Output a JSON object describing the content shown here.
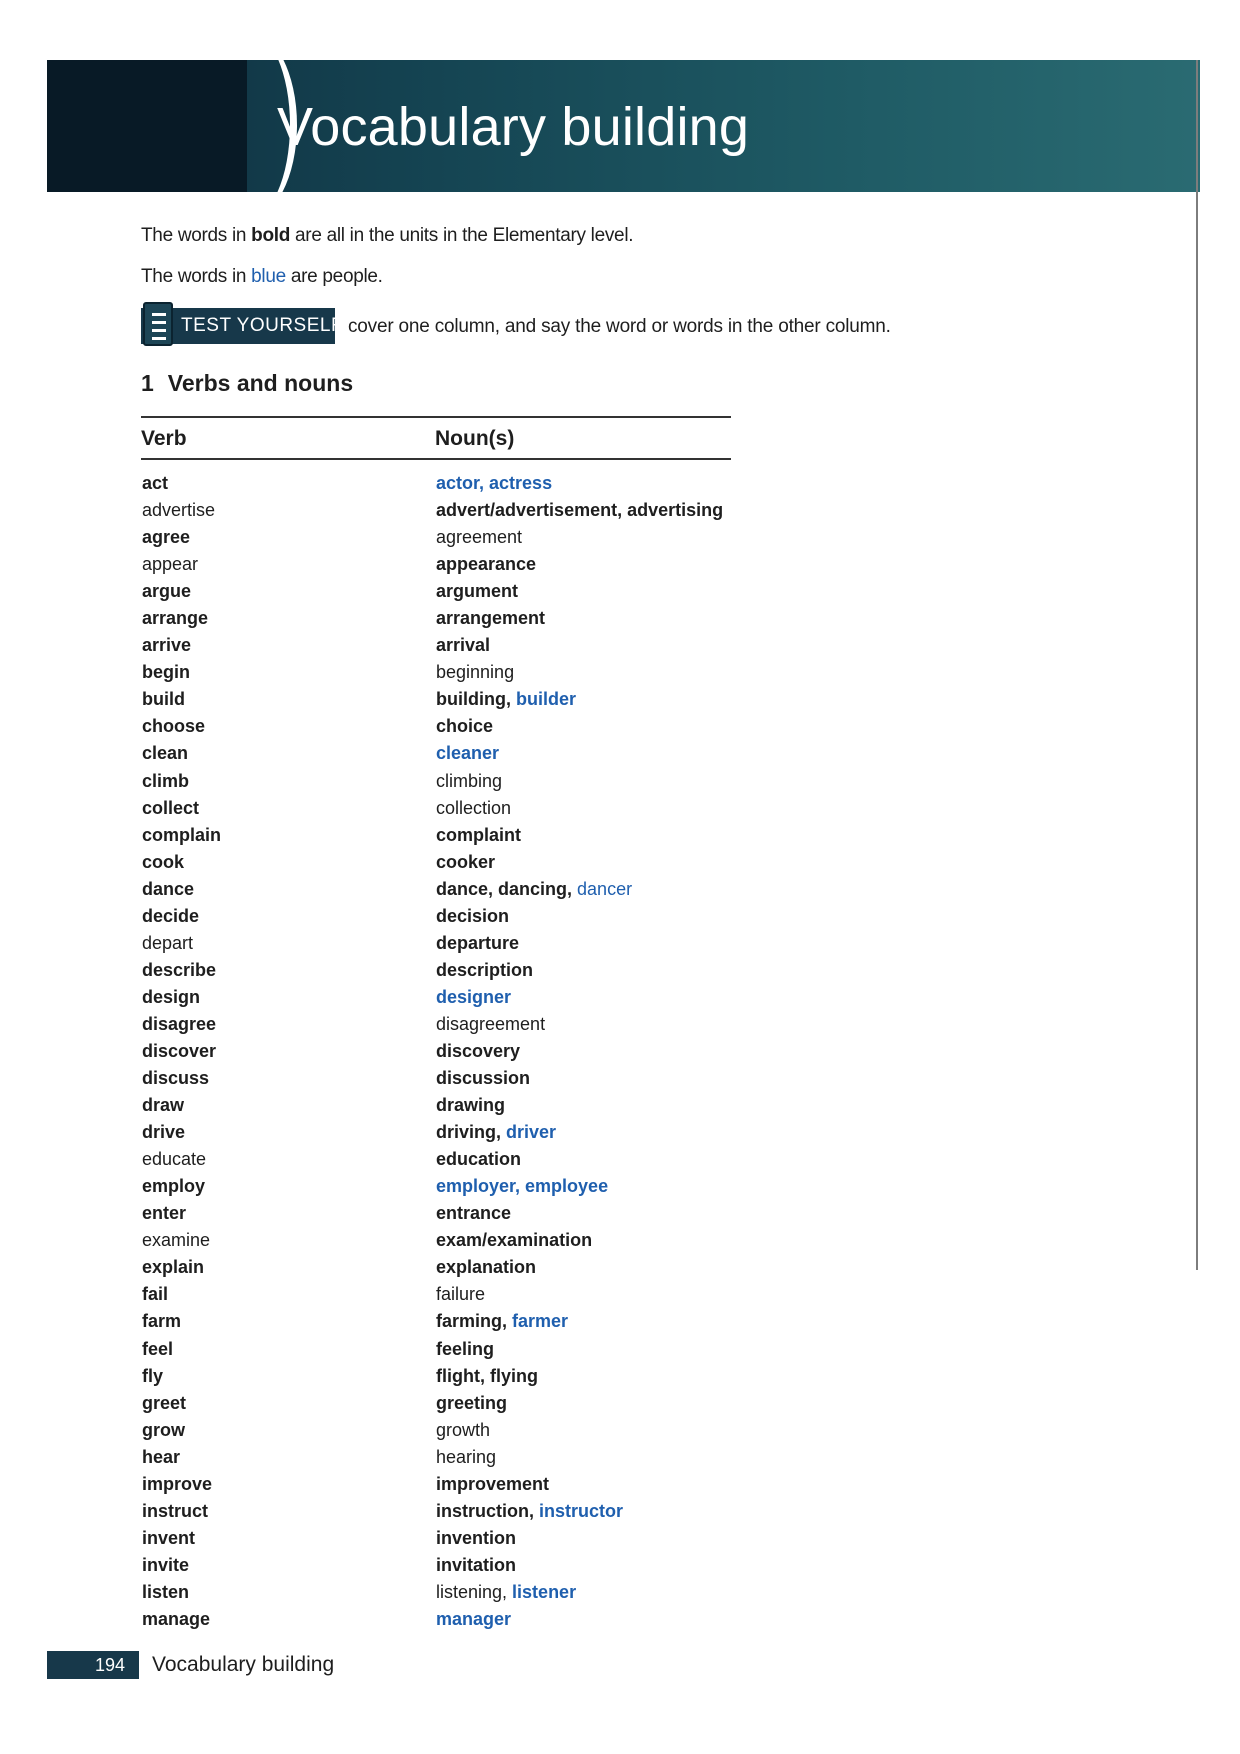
{
  "header": {
    "title": "Vocabulary building"
  },
  "intro": {
    "line1": {
      "pre": "The words in ",
      "bold": "bold",
      "post": " are all in the units in the Elementary level."
    },
    "line2": {
      "pre": "The words in ",
      "blue": "blue",
      "post": " are people."
    }
  },
  "test_yourself": {
    "label": "TEST YOURSELF",
    "text": "cover one column, and say the word or words in the other column."
  },
  "section": {
    "number": "1",
    "title": "Verbs and nouns"
  },
  "colors": {
    "bold_text": "#1e1e1e",
    "people_blue": "#1f5fae",
    "header_band": "#154553"
  },
  "table": {
    "headers": {
      "verb": "Verb",
      "noun": "Noun(s)"
    },
    "rows": [
      {
        "verb": {
          "text": "act",
          "bold": true
        },
        "nouns": [
          {
            "text": "actor, actress",
            "bold": true,
            "blue": true
          }
        ]
      },
      {
        "verb": {
          "text": "advertise",
          "bold": false
        },
        "nouns": [
          {
            "text": "advert/advertisement, advertising",
            "bold": true,
            "blue": false
          }
        ]
      },
      {
        "verb": {
          "text": "agree",
          "bold": true
        },
        "nouns": [
          {
            "text": "agreement",
            "bold": false,
            "blue": false
          }
        ]
      },
      {
        "verb": {
          "text": "appear",
          "bold": false
        },
        "nouns": [
          {
            "text": "appearance",
            "bold": true,
            "blue": false
          }
        ]
      },
      {
        "verb": {
          "text": "argue",
          "bold": true
        },
        "nouns": [
          {
            "text": "argument",
            "bold": true,
            "blue": false
          }
        ]
      },
      {
        "verb": {
          "text": "arrange",
          "bold": true
        },
        "nouns": [
          {
            "text": "arrangement",
            "bold": true,
            "blue": false
          }
        ]
      },
      {
        "verb": {
          "text": "arrive",
          "bold": true
        },
        "nouns": [
          {
            "text": "arrival",
            "bold": true,
            "blue": false
          }
        ]
      },
      {
        "verb": {
          "text": "begin",
          "bold": true
        },
        "nouns": [
          {
            "text": "beginning",
            "bold": false,
            "blue": false
          }
        ]
      },
      {
        "verb": {
          "text": "build",
          "bold": true
        },
        "nouns": [
          {
            "text": "building, ",
            "bold": true,
            "blue": false
          },
          {
            "text": "builder",
            "bold": true,
            "blue": true
          }
        ]
      },
      {
        "verb": {
          "text": "choose",
          "bold": true
        },
        "nouns": [
          {
            "text": "choice",
            "bold": true,
            "blue": false
          }
        ]
      },
      {
        "verb": {
          "text": "clean",
          "bold": true
        },
        "nouns": [
          {
            "text": "cleaner",
            "bold": true,
            "blue": true
          }
        ]
      },
      {
        "verb": {
          "text": "climb",
          "bold": true
        },
        "nouns": [
          {
            "text": "climbing",
            "bold": false,
            "blue": false
          }
        ]
      },
      {
        "verb": {
          "text": "collect",
          "bold": true
        },
        "nouns": [
          {
            "text": "collection",
            "bold": false,
            "blue": false
          }
        ]
      },
      {
        "verb": {
          "text": "complain",
          "bold": true
        },
        "nouns": [
          {
            "text": "complaint",
            "bold": true,
            "blue": false
          }
        ]
      },
      {
        "verb": {
          "text": "cook",
          "bold": true
        },
        "nouns": [
          {
            "text": "cooker",
            "bold": true,
            "blue": false
          }
        ]
      },
      {
        "verb": {
          "text": "dance",
          "bold": true
        },
        "nouns": [
          {
            "text": "dance, dancing, ",
            "bold": true,
            "blue": false
          },
          {
            "text": "dancer",
            "bold": false,
            "blue": true
          }
        ]
      },
      {
        "verb": {
          "text": "decide",
          "bold": true
        },
        "nouns": [
          {
            "text": "decision",
            "bold": true,
            "blue": false
          }
        ]
      },
      {
        "verb": {
          "text": "depart",
          "bold": false
        },
        "nouns": [
          {
            "text": "departure",
            "bold": true,
            "blue": false
          }
        ]
      },
      {
        "verb": {
          "text": "describe",
          "bold": true
        },
        "nouns": [
          {
            "text": "description",
            "bold": true,
            "blue": false
          }
        ]
      },
      {
        "verb": {
          "text": "design",
          "bold": true
        },
        "nouns": [
          {
            "text": "designer",
            "bold": true,
            "blue": true
          }
        ]
      },
      {
        "verb": {
          "text": "disagree",
          "bold": true
        },
        "nouns": [
          {
            "text": "disagreement",
            "bold": false,
            "blue": false
          }
        ]
      },
      {
        "verb": {
          "text": "discover",
          "bold": true
        },
        "nouns": [
          {
            "text": "discovery",
            "bold": true,
            "blue": false
          }
        ]
      },
      {
        "verb": {
          "text": "discuss",
          "bold": true
        },
        "nouns": [
          {
            "text": "discussion",
            "bold": true,
            "blue": false
          }
        ]
      },
      {
        "verb": {
          "text": "draw",
          "bold": true
        },
        "nouns": [
          {
            "text": "drawing",
            "bold": true,
            "blue": false
          }
        ]
      },
      {
        "verb": {
          "text": "drive",
          "bold": true
        },
        "nouns": [
          {
            "text": "driving, ",
            "bold": true,
            "blue": false
          },
          {
            "text": "driver",
            "bold": true,
            "blue": true
          }
        ]
      },
      {
        "verb": {
          "text": "educate",
          "bold": false
        },
        "nouns": [
          {
            "text": "education",
            "bold": true,
            "blue": false
          }
        ]
      },
      {
        "verb": {
          "text": "employ",
          "bold": true
        },
        "nouns": [
          {
            "text": "employer, employee",
            "bold": true,
            "blue": true
          }
        ]
      },
      {
        "verb": {
          "text": "enter",
          "bold": true
        },
        "nouns": [
          {
            "text": "entrance",
            "bold": true,
            "blue": false
          }
        ]
      },
      {
        "verb": {
          "text": "examine",
          "bold": false
        },
        "nouns": [
          {
            "text": "exam/examination",
            "bold": true,
            "blue": false
          }
        ]
      },
      {
        "verb": {
          "text": "explain",
          "bold": true
        },
        "nouns": [
          {
            "text": "explanation",
            "bold": true,
            "blue": false
          }
        ]
      },
      {
        "verb": {
          "text": "fail",
          "bold": true
        },
        "nouns": [
          {
            "text": "failure",
            "bold": false,
            "blue": false
          }
        ]
      },
      {
        "verb": {
          "text": "farm",
          "bold": true
        },
        "nouns": [
          {
            "text": "farming, ",
            "bold": true,
            "blue": false
          },
          {
            "text": "farmer",
            "bold": true,
            "blue": true
          }
        ]
      },
      {
        "verb": {
          "text": "feel",
          "bold": true
        },
        "nouns": [
          {
            "text": "feeling",
            "bold": true,
            "blue": false
          }
        ]
      },
      {
        "verb": {
          "text": "fly",
          "bold": true
        },
        "nouns": [
          {
            "text": "flight, flying",
            "bold": true,
            "blue": false
          }
        ]
      },
      {
        "verb": {
          "text": "greet",
          "bold": true
        },
        "nouns": [
          {
            "text": "greeting",
            "bold": true,
            "blue": false
          }
        ]
      },
      {
        "verb": {
          "text": "grow",
          "bold": true
        },
        "nouns": [
          {
            "text": "growth",
            "bold": false,
            "blue": false
          }
        ]
      },
      {
        "verb": {
          "text": "hear",
          "bold": true
        },
        "nouns": [
          {
            "text": "hearing",
            "bold": false,
            "blue": false
          }
        ]
      },
      {
        "verb": {
          "text": "improve",
          "bold": true
        },
        "nouns": [
          {
            "text": "improvement",
            "bold": true,
            "blue": false
          }
        ]
      },
      {
        "verb": {
          "text": "instruct",
          "bold": true
        },
        "nouns": [
          {
            "text": "instruction, ",
            "bold": true,
            "blue": false
          },
          {
            "text": "instructor",
            "bold": true,
            "blue": true
          }
        ]
      },
      {
        "verb": {
          "text": "invent",
          "bold": true
        },
        "nouns": [
          {
            "text": "invention",
            "bold": true,
            "blue": false
          }
        ]
      },
      {
        "verb": {
          "text": "invite",
          "bold": true
        },
        "nouns": [
          {
            "text": "invitation",
            "bold": true,
            "blue": false
          }
        ]
      },
      {
        "verb": {
          "text": "listen",
          "bold": true
        },
        "nouns": [
          {
            "text": "listening, ",
            "bold": false,
            "blue": false
          },
          {
            "text": "listener",
            "bold": true,
            "blue": true
          }
        ]
      },
      {
        "verb": {
          "text": "manage",
          "bold": true
        },
        "nouns": [
          {
            "text": "manager",
            "bold": true,
            "blue": true
          }
        ]
      }
    ]
  },
  "footer": {
    "page_number": "194",
    "text": "Vocabulary building"
  }
}
